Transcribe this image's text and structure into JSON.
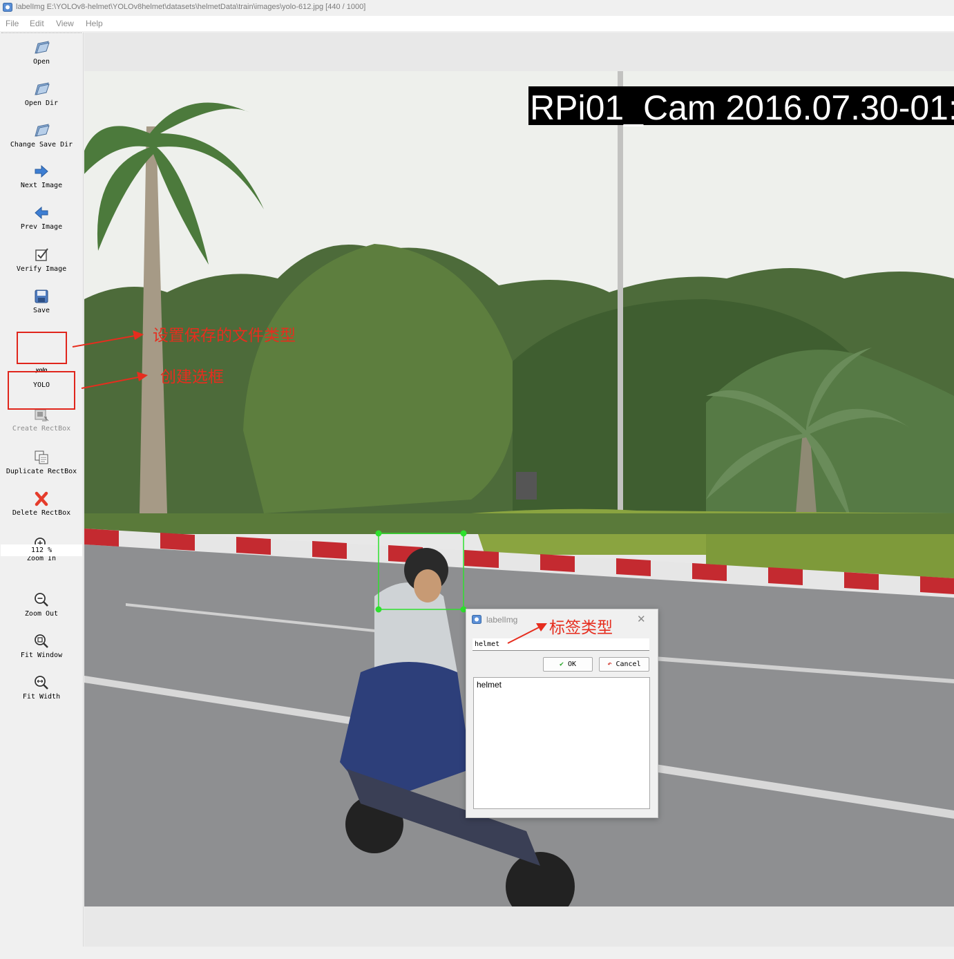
{
  "window": {
    "title": "labelImg E:\\YOLOv8-helmet\\YOLOv8helmet\\datasets\\helmetData\\train\\images\\yolo-612.jpg [440 / 1000]"
  },
  "menu": [
    "File",
    "Edit",
    "View",
    "Help"
  ],
  "toolbar": {
    "open": "Open",
    "open_dir": "Open Dir",
    "change_save_dir": "Change Save Dir",
    "next_image": "Next Image",
    "prev_image": "Prev Image",
    "verify_image": "Verify Image",
    "save": "Save",
    "format_icon_text": "yolo",
    "format": "YOLO",
    "create_rectbox": "Create RectBox",
    "duplicate_rectbox": "Duplicate RectBox",
    "delete_rectbox": "Delete RectBox",
    "zoom_in": "Zoom In",
    "zoom_value": "112 %",
    "zoom_out": "Zoom Out",
    "fit_window": "Fit Window",
    "fit_width": "Fit Width"
  },
  "image": {
    "overlay_text": "RPi01_Cam  2016.07.30-01:"
  },
  "annotations": {
    "save_format": "设置保存的文件类型",
    "create_box": "创建选框",
    "label_type": "标签类型"
  },
  "dialog": {
    "title": "labelImg",
    "input_value": "helmet",
    "ok": "OK",
    "cancel": "Cancel",
    "list_items": [
      "helmet"
    ]
  },
  "colors": {
    "annotation_red": "#e62d1e",
    "bbox_green": "#2ee02e"
  }
}
